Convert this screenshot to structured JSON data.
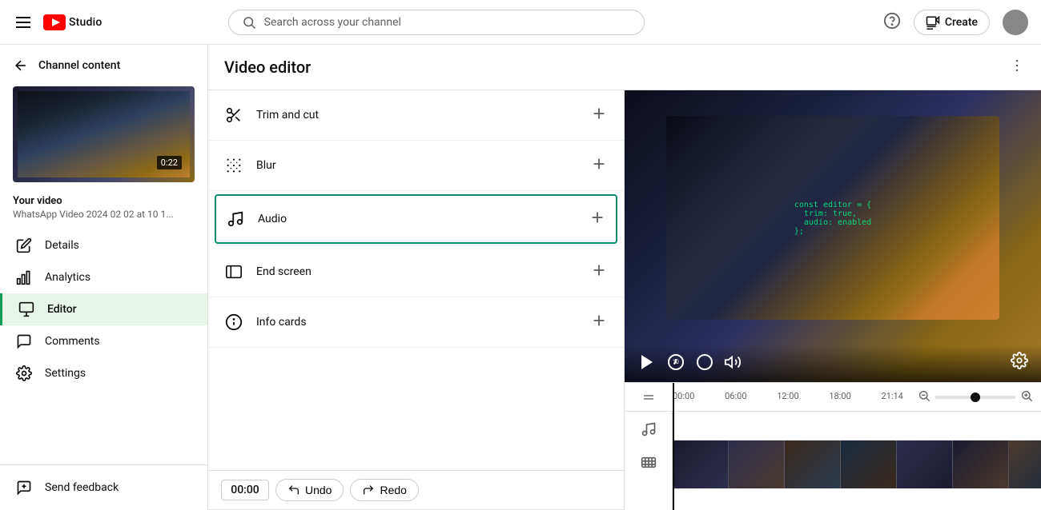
{
  "topbar": {
    "search_placeholder": "Search across your channel",
    "create_label": "Create",
    "logo_text": "Studio"
  },
  "sidebar": {
    "back_label": "Channel content",
    "video": {
      "duration": "0:22",
      "label": "Your video",
      "filename": "WhatsApp Video 2024 02 02 at 10 1..."
    },
    "nav_items": [
      {
        "id": "details",
        "label": "Details",
        "icon": "pencil"
      },
      {
        "id": "analytics",
        "label": "Analytics",
        "icon": "bar-chart"
      },
      {
        "id": "editor",
        "label": "Editor",
        "icon": "editor",
        "active": true
      },
      {
        "id": "comments",
        "label": "Comments",
        "icon": "comment"
      },
      {
        "id": "settings",
        "label": "Settings",
        "icon": "gear"
      }
    ],
    "bottom_items": [
      {
        "id": "send-feedback",
        "label": "Send feedback",
        "icon": "flag"
      }
    ]
  },
  "editor": {
    "title": "Video editor",
    "tools": [
      {
        "id": "trim",
        "label": "Trim and cut",
        "icon": "scissors",
        "active": false
      },
      {
        "id": "blur",
        "label": "Blur",
        "icon": "dots-grid",
        "active": false
      },
      {
        "id": "audio",
        "label": "Audio",
        "icon": "music-note",
        "active": true
      },
      {
        "id": "end-screen",
        "label": "End screen",
        "icon": "end-screen",
        "active": false
      },
      {
        "id": "info-cards",
        "label": "Info cards",
        "icon": "info-circle",
        "active": false
      }
    ],
    "timeline": {
      "current_time": "00:00",
      "undo_label": "Undo",
      "redo_label": "Redo",
      "marks": [
        "00:00",
        "06:00",
        "12:00",
        "18:00",
        "21:14"
      ]
    }
  }
}
